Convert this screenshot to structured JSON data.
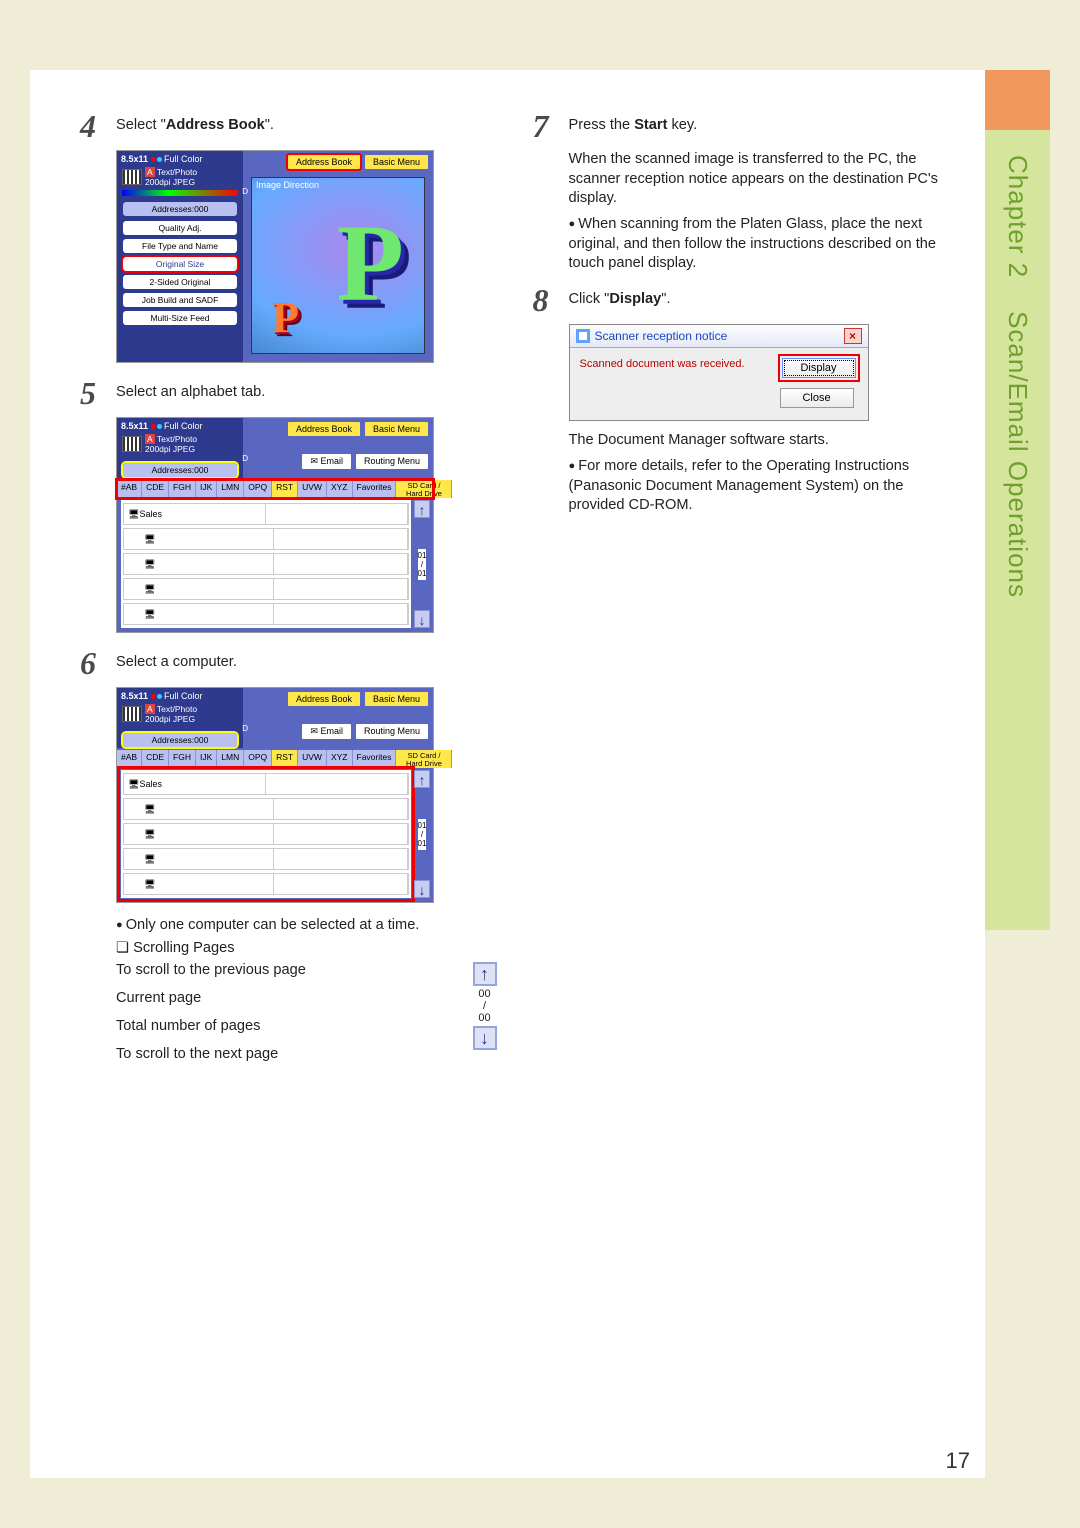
{
  "chapter": {
    "label": "Chapter 2",
    "title": "Scan/Email Operations"
  },
  "page_number": "17",
  "steps": {
    "4": {
      "num": "4",
      "text_pre": "Select \"",
      "bold": "Address Book",
      "text_post": "\"."
    },
    "5": {
      "num": "5",
      "text": "Select an alphabet tab."
    },
    "6": {
      "num": "6",
      "text": "Select a computer.",
      "bullet": "Only one computer can be selected at a time.",
      "scrolling_title": "Scrolling Pages",
      "pager": {
        "prev": "To scroll to the previous page",
        "current_label": "Current page",
        "total_label": "Total number of pages",
        "next": "To scroll to the next page",
        "current": "00",
        "total": "00"
      }
    },
    "7": {
      "num": "7",
      "text_pre": "Press the ",
      "bold": "Start",
      "text_post": " key.",
      "para": "When the scanned image is transferred to the PC, the scanner reception notice appears on the destination PC's display.",
      "bullet": "When scanning from the Platen Glass, place the next original, and then follow the instructions described on the touch panel display."
    },
    "8": {
      "num": "8",
      "text_pre": "Click \"",
      "bold": "Display",
      "text_post": "\".",
      "after_dialog": "The Document Manager software starts.",
      "bullet": "For more details, refer to the Operating Instructions (Panasonic Document Management System) on the provided CD-ROM."
    }
  },
  "dialog": {
    "title": "Scanner reception notice",
    "message": "Scanned document was received.",
    "display": "Display",
    "close": "Close"
  },
  "mfp": {
    "size": "8.5x11",
    "full_color": "Full Color",
    "mode": "Text/Photo",
    "res": "200dpi JPEG",
    "addresses_btn": "Addresses:000",
    "opts": {
      "quality": "Quality Adj.",
      "filetype": "File Type and Name",
      "original_size": "Original Size",
      "two_sided": "2-Sided Original",
      "job_build": "Job Build and SADF",
      "multi_size": "Multi-Size Feed"
    },
    "tabs": {
      "address_book": "Address Book",
      "basic_menu": "Basic Menu"
    },
    "image_direction": "Image Direction",
    "email": "Email",
    "routing_menu": "Routing Menu",
    "alpha": [
      "#AB",
      "CDE",
      "FGH",
      "IJK",
      "LMN",
      "OPQ",
      "RST",
      "UVW",
      "XYZ"
    ],
    "favorites": "Favorites",
    "sd_card": "SD Card / Hard Drive",
    "sales": "Sales",
    "page_current": "01",
    "page_total": "01"
  }
}
